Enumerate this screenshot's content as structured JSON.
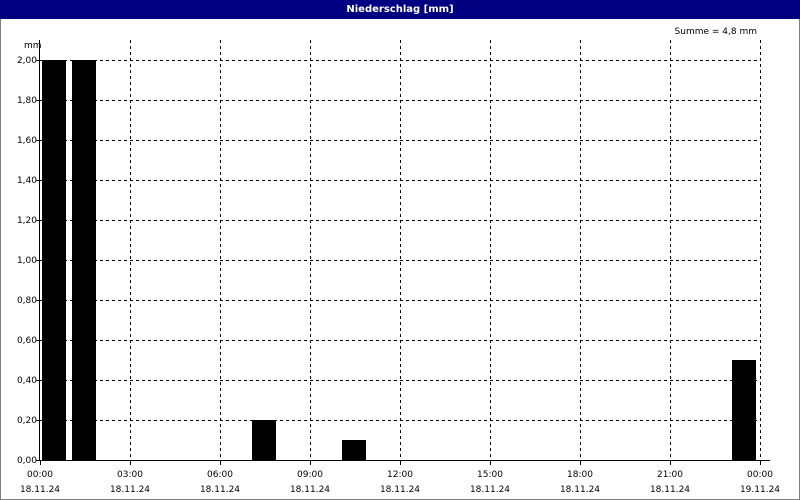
{
  "window": {
    "title": "Niederschlag [mm]"
  },
  "summary": "Summe = 4,8 mm",
  "chart_data": {
    "type": "bar",
    "title": "Niederschlag [mm]",
    "ylabel": "mm",
    "xlabel": "",
    "ylim": [
      0,
      2.0
    ],
    "yticks": [
      "0,00",
      "0,20",
      "0,40",
      "0,60",
      "0,80",
      "1,00",
      "1,20",
      "1,40",
      "1,60",
      "1,80",
      "2,00"
    ],
    "xticks": [
      {
        "time": "00:00",
        "date": "18.11.24"
      },
      {
        "time": "03:00",
        "date": "18.11.24"
      },
      {
        "time": "06:00",
        "date": "18.11.24"
      },
      {
        "time": "09:00",
        "date": "18.11.24"
      },
      {
        "time": "12:00",
        "date": "18.11.24"
      },
      {
        "time": "15:00",
        "date": "18.11.24"
      },
      {
        "time": "18:00",
        "date": "18.11.24"
      },
      {
        "time": "21:00",
        "date": "18.11.24"
      },
      {
        "time": "00:00",
        "date": "19.11.24"
      }
    ],
    "bars": [
      {
        "start": "18.11.24 00:00",
        "end": "18.11.24 01:00",
        "value": 2.0
      },
      {
        "start": "18.11.24 01:00",
        "end": "18.11.24 02:00",
        "value": 2.0
      },
      {
        "start": "18.11.24 07:00",
        "end": "18.11.24 08:00",
        "value": 0.2
      },
      {
        "start": "18.11.24 10:00",
        "end": "18.11.24 11:00",
        "value": 0.1
      },
      {
        "start": "18.11.24 23:00",
        "end": "19.11.24 00:00",
        "value": 0.5
      }
    ],
    "bar_color": "#000000",
    "grid": true
  }
}
